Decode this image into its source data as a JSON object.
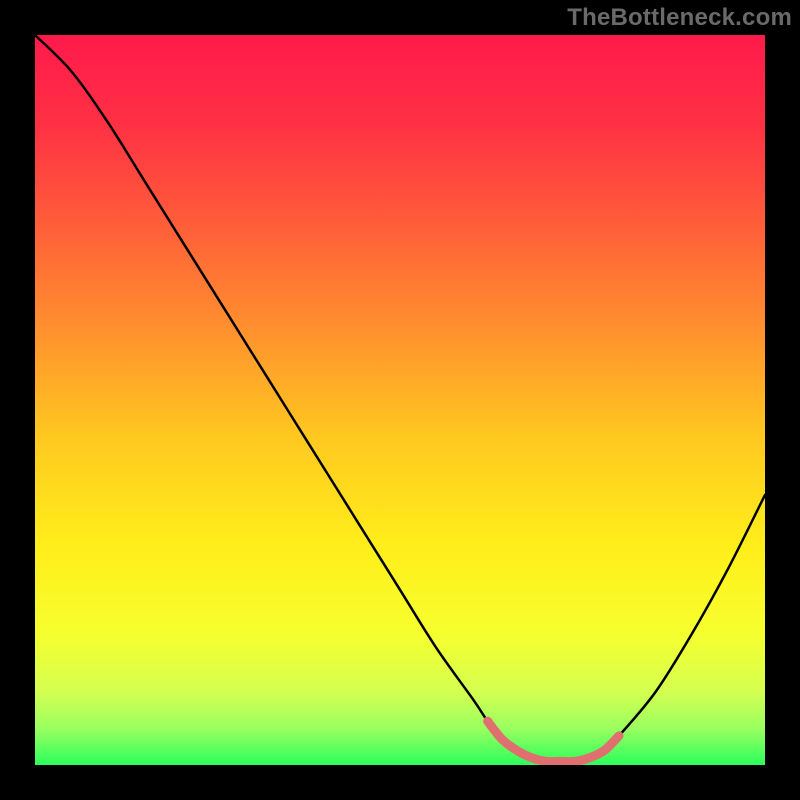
{
  "watermark": "TheBottleneck.com",
  "chart_data": {
    "type": "line",
    "title": "",
    "xlabel": "",
    "ylabel": "",
    "xlim": [
      0,
      100
    ],
    "ylim": [
      0,
      100
    ],
    "grid": false,
    "legend": "none",
    "series": [
      {
        "name": "bottleneck-curve",
        "x": [
          0,
          5,
          10,
          15,
          20,
          25,
          30,
          35,
          40,
          45,
          50,
          55,
          60,
          62,
          64,
          66,
          68,
          70,
          72,
          74,
          76,
          78,
          80,
          85,
          90,
          95,
          100
        ],
        "values": [
          100,
          95,
          88,
          80,
          72,
          64,
          56,
          48,
          40,
          32,
          24,
          16,
          9,
          6,
          3.5,
          2,
          1,
          0.5,
          0.5,
          0.5,
          1,
          2,
          4,
          10,
          18,
          27,
          37
        ]
      },
      {
        "name": "bottleneck-highlight",
        "x": [
          62,
          64,
          66,
          68,
          70,
          72,
          74,
          76,
          78,
          80
        ],
        "values": [
          6,
          3.5,
          2,
          1,
          0.5,
          0.5,
          0.5,
          1,
          2,
          4
        ]
      }
    ],
    "gradient_stops": [
      {
        "offset": 0.0,
        "color": "#ff1a4b"
      },
      {
        "offset": 0.12,
        "color": "#ff3044"
      },
      {
        "offset": 0.25,
        "color": "#ff5a3a"
      },
      {
        "offset": 0.4,
        "color": "#ff8f2e"
      },
      {
        "offset": 0.55,
        "color": "#ffc820"
      },
      {
        "offset": 0.7,
        "color": "#ffee1a"
      },
      {
        "offset": 0.82,
        "color": "#f6ff2e"
      },
      {
        "offset": 0.9,
        "color": "#d4ff50"
      },
      {
        "offset": 0.95,
        "color": "#9aff60"
      },
      {
        "offset": 1.0,
        "color": "#2bff5c"
      }
    ],
    "curve_color": "#000000",
    "highlight_color": "#e07070"
  }
}
